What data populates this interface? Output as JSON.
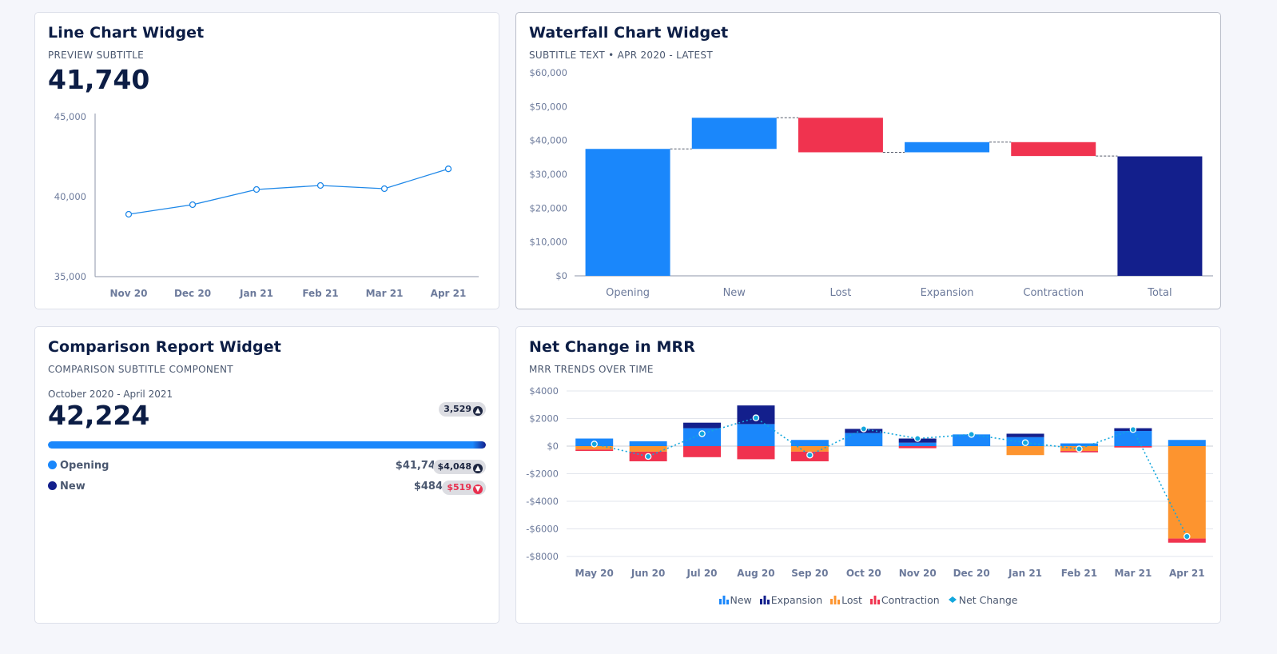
{
  "line_widget": {
    "title": "Line Chart Widget",
    "subtitle": "PREVIEW SUBTITLE",
    "value": "41,740"
  },
  "waterfall_widget": {
    "title": "Waterfall Chart Widget",
    "subtitle": "SUBTITLE TEXT • APR 2020 - LATEST"
  },
  "comparison_widget": {
    "title": "Comparison Report Widget",
    "subtitle": "COMPARISON SUBTITLE COMPONENT",
    "period": "October 2020 - April 2021",
    "value": "42,224",
    "total_change": "3,529",
    "progress_fraction": 1.0,
    "rows": [
      {
        "label": "Opening",
        "value": "$41,740",
        "change": "$4,048",
        "direction": "up",
        "color": "#1a87fb"
      },
      {
        "label": "New",
        "value": "$484",
        "change": "$519",
        "direction": "down",
        "color": "#131f8c"
      }
    ]
  },
  "mrr_widget": {
    "title": "Net Change in MRR",
    "subtitle": "MRR TRENDS OVER TIME",
    "legend": [
      "New",
      "Expansion",
      "Lost",
      "Contraction",
      "Net Change"
    ]
  },
  "colors": {
    "blue": "#1a87fb",
    "navy": "#131f8c",
    "red": "#f0334f",
    "orange": "#fd942f",
    "line": "#1f88e8",
    "net": "#13a7dd"
  },
  "chart_data": [
    {
      "type": "line",
      "categories": [
        "Nov 20",
        "Dec 20",
        "Jan 21",
        "Feb 21",
        "Mar 21",
        "Apr 21"
      ],
      "values": [
        38900,
        39500,
        40450,
        40700,
        40500,
        41740
      ],
      "ylim": [
        35000,
        45000
      ],
      "yticks": [
        "35,000",
        "40,000",
        "45,000"
      ],
      "grid": false
    },
    {
      "type": "bar",
      "subtype": "waterfall",
      "categories": [
        "Opening",
        "New",
        "Lost",
        "Expansion",
        "Contraction",
        "Total"
      ],
      "values": [
        37500,
        9200,
        -10200,
        3000,
        -4100,
        35300
      ],
      "ylim": [
        0,
        60000
      ],
      "yticks": [
        "$0",
        "$10,000",
        "$20,000",
        "$30,000",
        "$40,000",
        "$50,000",
        "$60,000"
      ]
    },
    {
      "type": "bar",
      "subtype": "stacked",
      "categories": [
        "May 20",
        "Jun 20",
        "Jul 20",
        "Aug 20",
        "Sep 20",
        "Oct 20",
        "Nov 20",
        "Dec 20",
        "Jan 21",
        "Feb 21",
        "Mar 21",
        "Apr 21"
      ],
      "series": [
        {
          "name": "New",
          "values": [
            550,
            350,
            1300,
            1600,
            450,
            950,
            250,
            850,
            650,
            200,
            1100,
            450
          ]
        },
        {
          "name": "Expansion",
          "values": [
            0,
            0,
            400,
            1350,
            0,
            300,
            300,
            0,
            250,
            0,
            200,
            0
          ]
        },
        {
          "name": "Lost",
          "values": [
            -250,
            -400,
            0,
            0,
            -400,
            0,
            0,
            0,
            -650,
            -350,
            0,
            -6700
          ]
        },
        {
          "name": "Contraction",
          "values": [
            -100,
            -700,
            -800,
            -950,
            -700,
            0,
            -150,
            0,
            0,
            -100,
            -100,
            -300
          ]
        },
        {
          "name": "Net Change",
          "values": [
            150,
            -750,
            900,
            2050,
            -650,
            1250,
            550,
            850,
            250,
            -200,
            1200,
            -6550
          ]
        }
      ],
      "ylim": [
        -8000,
        4000
      ],
      "yticks": [
        "-$8000",
        "-$6000",
        "-$4000",
        "-$2000",
        "$0",
        "$2000",
        "$4000"
      ],
      "grid": true,
      "legend_position": "bottom"
    }
  ]
}
